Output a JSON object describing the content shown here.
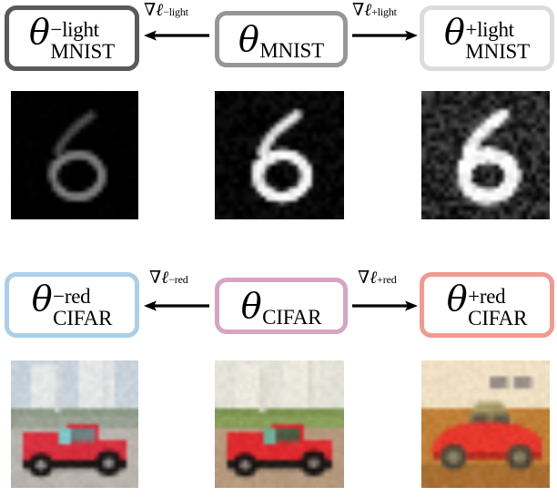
{
  "figure": {
    "title": "Parameter perturbation diagram: MNIST brightness and CIFAR redness",
    "rows": [
      {
        "id": "mnist",
        "dataset": "MNIST",
        "boxes": [
          {
            "id": "mnist-neg",
            "theta": "θ",
            "superscript": "−light",
            "subscript": "MNIST",
            "border_color": "#5a5a5a",
            "border_width": 5
          },
          {
            "id": "mnist-base",
            "theta": "θ",
            "superscript": "",
            "subscript": "MNIST",
            "border_color": "#969696",
            "border_width": 5
          },
          {
            "id": "mnist-pos",
            "theta": "θ",
            "superscript": "+light",
            "subscript": "MNIST",
            "border_color": "#dcdcdc",
            "border_width": 5
          }
        ],
        "arrows": [
          {
            "id": "mnist-grad-neg",
            "direction": "left",
            "nabla": "∇",
            "ell": "ℓ",
            "suffix": "−light"
          },
          {
            "id": "mnist-grad-pos",
            "direction": "right",
            "nabla": "∇",
            "ell": "ℓ",
            "suffix": "+light"
          }
        ],
        "samples": [
          {
            "id": "mnist-sample-neg",
            "label": "digit-6-dim",
            "digit": "6",
            "brightness": 0.55,
            "noise": 0.02,
            "stroke": 0.8,
            "bg": "#000000"
          },
          {
            "id": "mnist-sample-base",
            "label": "digit-6-normal",
            "digit": "6",
            "brightness": 0.95,
            "noise": 0.1,
            "stroke": 1.0,
            "bg": "#050505"
          },
          {
            "id": "mnist-sample-pos",
            "label": "digit-6-bright",
            "digit": "6",
            "brightness": 1.0,
            "noise": 0.3,
            "stroke": 1.3,
            "bg": "#202020"
          }
        ]
      },
      {
        "id": "cifar",
        "dataset": "CIFAR",
        "boxes": [
          {
            "id": "cifar-neg",
            "theta": "θ",
            "superscript": "−red",
            "subscript": "CIFAR",
            "border_color": "#a9cfe9",
            "border_width": 5
          },
          {
            "id": "cifar-base",
            "theta": "θ",
            "superscript": "",
            "subscript": "CIFAR",
            "border_color": "#d6a5c3",
            "border_width": 5
          },
          {
            "id": "cifar-pos",
            "theta": "θ",
            "superscript": "+red",
            "subscript": "CIFAR",
            "border_color": "#f09a92",
            "border_width": 5
          }
        ],
        "arrows": [
          {
            "id": "cifar-grad-neg",
            "direction": "left",
            "nabla": "∇",
            "ell": "ℓ",
            "suffix": "−red"
          },
          {
            "id": "cifar-grad-pos",
            "direction": "right",
            "nabla": "∇",
            "ell": "ℓ",
            "suffix": "+red"
          }
        ],
        "samples": [
          {
            "id": "cifar-sample-neg",
            "label": "red-truck-cool",
            "scene": "truck",
            "tint": "cool",
            "sky": "#c9d3dc",
            "ground": "#b9b4ae",
            "body": "#d9303f"
          },
          {
            "id": "cifar-sample-base",
            "label": "red-truck-normal",
            "scene": "truck",
            "tint": "neutral",
            "sky": "#e3e2d8",
            "ground": "#b79a80",
            "body": "#e02b30"
          },
          {
            "id": "cifar-sample-pos",
            "label": "red-car-warm",
            "scene": "car",
            "tint": "warm",
            "sky": "#f0e0c4",
            "ground": "#c08038",
            "body": "#e8372c"
          }
        ]
      }
    ]
  }
}
